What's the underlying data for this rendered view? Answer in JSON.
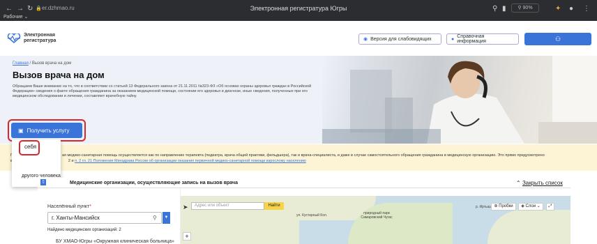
{
  "browser": {
    "url": "er.dzhmao.ru",
    "window_title": "Электронная регистратура Югры",
    "bookmarks_label": "Рабочие",
    "zoom": "90%"
  },
  "header": {
    "logo_text": "Электронная регистратура",
    "low_vision_label": "Версия для слабовидящих",
    "help_label": "Справочная информация"
  },
  "breadcrumb": {
    "home": "Главная",
    "current": "/ Вызов врача на дом"
  },
  "page": {
    "title": "Вызов врача на дом",
    "notice": "Обращаем Ваше внимание на то, что в соответствии со статьей 13 Федерального закона от 21.11.2011 №323-ФЗ «Об основах охраны здоровья граждан в Российской Федерации» сведения о факте обращения гражданина за оказанием медицинской помощи, состоянии его здоровья и диагнозе, иные сведения, полученные при его медицинском обследовании и лечении, составляют врачебную тайну.",
    "service_button": "Получить услугу"
  },
  "dropdown": {
    "self": "себя",
    "other": "другого человека"
  },
  "info": {
    "text_start": "П",
    "text_main": "ая медико-санитарная помощь осуществляется как по направлению терапевта (педиатра, врача общей практики, фельдшера), так и врача-специалиста, и даже в случае самостоятельного обращения гражданина в медицинскую организацию. Это прямо предусмотрено",
    "text_line2_start": "в",
    "text_line2_pre": "2 и",
    "text_link": "п. 2 гл. 21 Положения Минздрава России об организации оказания первичной медико-санитарной помощи взрослому населению"
  },
  "orgs": {
    "title": "Медицинские организации, осуществляющие запись на вызов врача",
    "close_label": "Закрыть список",
    "city_label": "Населённый пункт",
    "city_value": "г. Ханты-Мансийск",
    "found_label": "Найдено медицинских организаций: 2",
    "first_org": "БУ ХМАО-Югры «Окружная клиническая больница»"
  },
  "map": {
    "search_placeholder": "Адрес или объект",
    "find_button": "Найти",
    "jams_button": "Пробки",
    "layers_button": "Слои",
    "zoom_in": "+",
    "label_park": "природный парк Самаровский Чугас",
    "label_street": "ул. Кустарный Кол.",
    "label_river": "р. Иртыш"
  },
  "colors": {
    "accent": "#3a74d9",
    "highlight_ring": "#d8262a",
    "info_bar": "#fdf4d5"
  }
}
